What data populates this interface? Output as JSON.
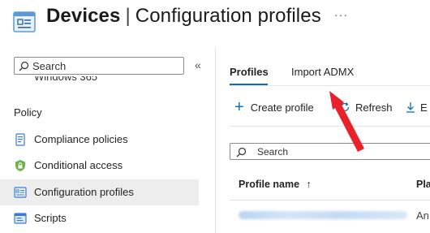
{
  "header": {
    "title_bold": "Devices",
    "title_separator": "|",
    "title_rest": "Configuration profiles",
    "more": "···"
  },
  "sidebar": {
    "search_placeholder": "Search",
    "collapse": "«",
    "partial_item": "Windows 365",
    "section": "Policy",
    "items": [
      {
        "label": "Compliance policies",
        "icon": "compliance-icon"
      },
      {
        "label": "Conditional access",
        "icon": "lock-shield-icon"
      },
      {
        "label": "Configuration profiles",
        "icon": "config-profile-icon",
        "active": true
      },
      {
        "label": "Scripts",
        "icon": "scripts-icon"
      }
    ]
  },
  "main": {
    "tabs": [
      {
        "label": "Profiles",
        "active": true
      },
      {
        "label": "Import ADMX",
        "active": false
      }
    ],
    "toolbar": {
      "create": "Create profile",
      "refresh": "Refresh",
      "export_partial": "E"
    },
    "grid_search_placeholder": "Search",
    "columns": [
      "Profile name",
      "Pla"
    ],
    "sort_indicator": "↑",
    "row": {
      "platform_partial": "An"
    }
  },
  "colors": {
    "accent": "#0f6cbd",
    "annotation_arrow": "#e8212b",
    "active_nav_bg": "#ededed"
  }
}
